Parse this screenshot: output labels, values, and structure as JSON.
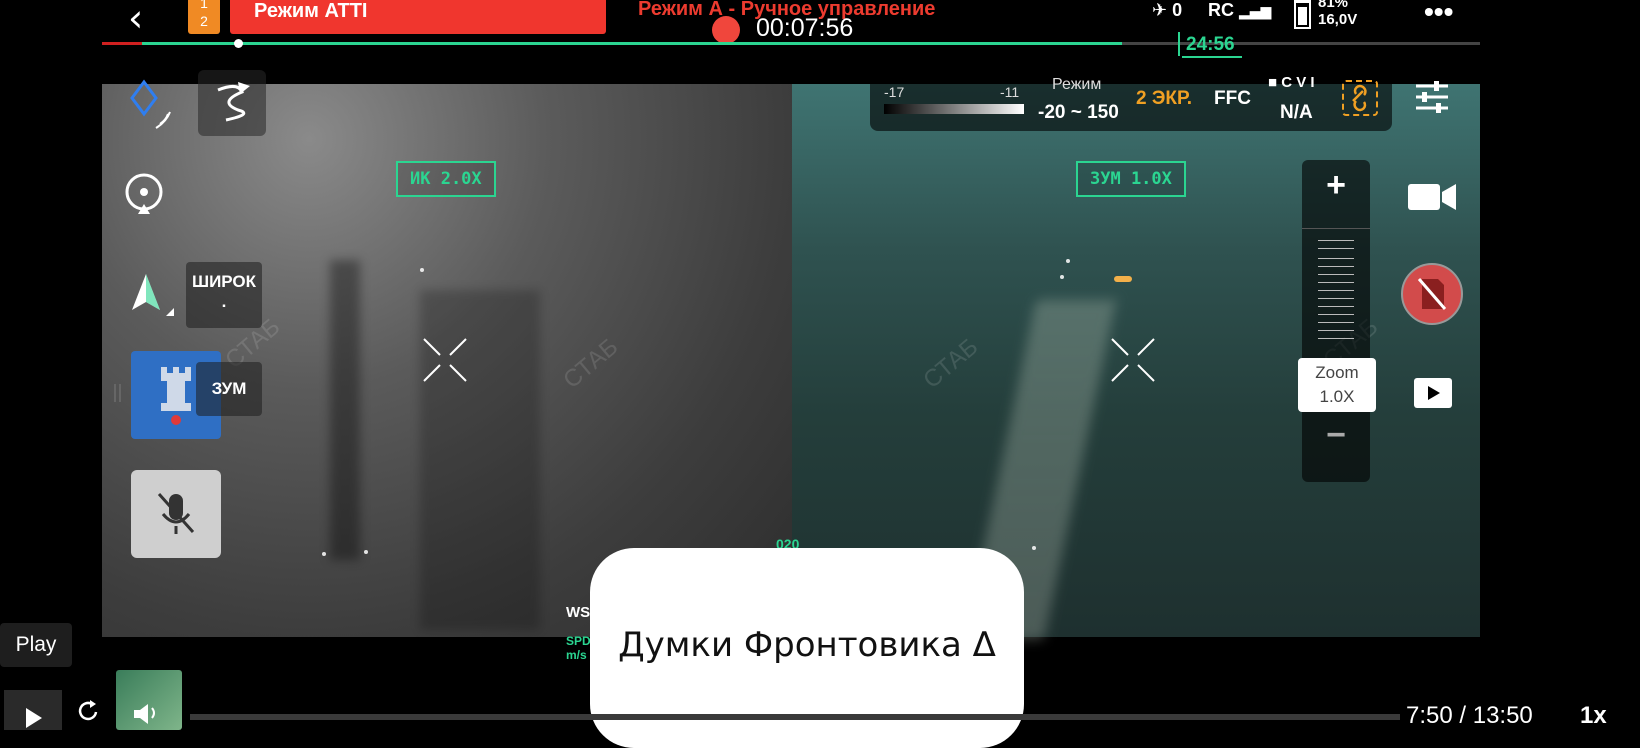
{
  "top_bar": {
    "back_icon": "chevron-left-icon",
    "mode_badge_top": "1",
    "mode_badge_bottom": "2",
    "atti_mode": "Режим ATTI",
    "control_mode": "Режим А - Ручное управление",
    "record_time": "00:07:56",
    "satellites": "0",
    "rc_label": "RC",
    "battery_percent": "81%",
    "voltage": "16,0V",
    "more_icon": "more-dots-icon",
    "flight_time_remaining": "24:56",
    "progress_fraction": 0.74
  },
  "left_pane": {
    "zoom_label": "ИК  2.0X",
    "wide_label": "ШИРОК",
    "wide_sub": ".",
    "zoom_mode_label": "ЗУМ",
    "watermark": "СТАБ",
    "bottom_text_1": "WS",
    "bottom_text_2": "SPD",
    "bottom_text_3": "m/s",
    "heading_value": "020"
  },
  "right_pane": {
    "zoom_label": "ЗУМ  1.0X",
    "watermark": "СТАБ"
  },
  "thermal_panel": {
    "range_low_label": "-17",
    "range_high_label": "-11",
    "mode_label": "Режим",
    "mode_range": "-20 ~ 150",
    "screens": "2 ЭКР.",
    "ffc": "FFC",
    "storage_label": "C V I",
    "storage_value": "N/A"
  },
  "zoom_slider": {
    "plus": "+",
    "minus": "−",
    "tooltip_title": "Zoom",
    "tooltip_value": "1.0X"
  },
  "overlay": {
    "channel_name": "Думки Фронтовика Δ"
  },
  "player": {
    "tooltip": "Play",
    "time": "7:50 / 13:50",
    "speed": "1x"
  },
  "colors": {
    "accent_green": "#2bd591",
    "warning_red": "#f0362e",
    "badge_orange": "#f08a24",
    "link_orange": "#f0a023",
    "zoom_blue": "#2f6fc4"
  }
}
